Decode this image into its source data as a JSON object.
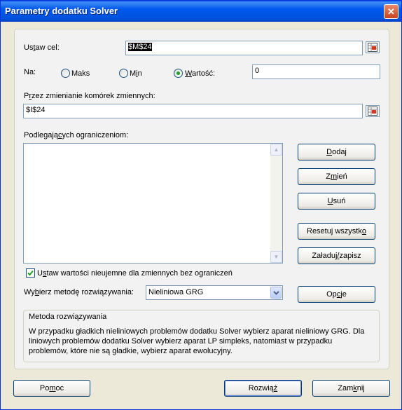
{
  "window": {
    "title": "Parametry dodatku Solver",
    "close_glyph": "✕"
  },
  "target": {
    "label_pre": "Us",
    "label_u": "t",
    "label_post": "aw cel:",
    "value": "$M$24",
    "ref_icon": "range-select-icon"
  },
  "to": {
    "label": "Na:",
    "options": [
      {
        "pre": "",
        "u": "",
        "post": "Maks",
        "checked": false
      },
      {
        "pre": "M",
        "u": "i",
        "post": "n",
        "checked": false
      },
      {
        "pre": "",
        "u": "W",
        "post": "artość:",
        "checked": true
      }
    ],
    "value": "0"
  },
  "changing": {
    "label_pre": "P",
    "label_u": "r",
    "label_post": "zez zmienianie komórek zmiennych:",
    "value": "$I$24"
  },
  "constraints": {
    "label_pre": "Podlegają",
    "label_u": "c",
    "label_post": "ych ograniczeniom:"
  },
  "buttons": {
    "add": {
      "pre": "",
      "u": "D",
      "post": "odaj"
    },
    "change": {
      "pre": "Z",
      "u": "m",
      "post": "ień"
    },
    "delete": {
      "pre": "",
      "u": "U",
      "post": "suń"
    },
    "reset": {
      "pre": "Resetuj wszystk",
      "u": "o",
      "post": ""
    },
    "load_save": {
      "pre": "Załaduj",
      "u": "/",
      "post": "zapisz"
    },
    "options": {
      "pre": "Op",
      "u": "c",
      "post": "je"
    },
    "help": {
      "pre": "Po",
      "u": "m",
      "post": "oc"
    },
    "solve": {
      "pre": "Rozwią",
      "u": "ż",
      "post": ""
    },
    "close": {
      "pre": "Zam",
      "u": "k",
      "post": "nij"
    }
  },
  "nonneg": {
    "pre": "U",
    "u": "s",
    "post": "taw wartości nieujemne dla zmiennych bez ograniczeń",
    "checked": true
  },
  "method": {
    "label_pre": "Wy",
    "label_u": "b",
    "label_post": "ierz metodę rozwiązywania:",
    "value": "Nieliniowa GRG"
  },
  "method_group": {
    "title": "Metoda rozwiązywania",
    "text": "W przypadku gładkich nieliniowych problemów dodatku Solver wybierz aparat nieliniowy GRG. Dla liniowych problemów dodatku Solver wybierz aparat LP simpleks, natomiast w przypadku problemów, które nie są gładkie, wybierz aparat ewolucyjny."
  }
}
